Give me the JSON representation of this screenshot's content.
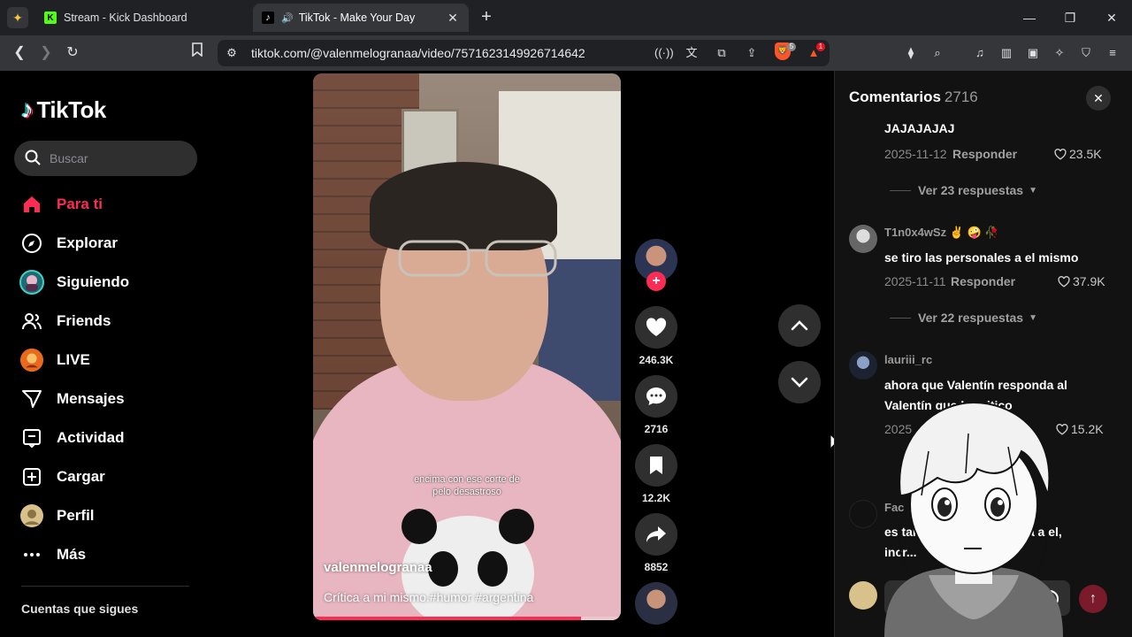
{
  "browser": {
    "tabs": [
      {
        "title": "Stream - Kick Dashboard",
        "active": false
      },
      {
        "title": "TikTok - Make Your Day",
        "active": true
      }
    ],
    "url": "tiktok.com/@valenmelogranaa/video/7571623149926714642",
    "brave_shields_count": "5",
    "rewards_count": "1"
  },
  "sidebar": {
    "logo": "TikTok",
    "search_placeholder": "Buscar",
    "items": [
      {
        "label": "Para ti",
        "icon": "home-icon",
        "active": true
      },
      {
        "label": "Explorar",
        "icon": "compass-icon"
      },
      {
        "label": "Siguiendo",
        "icon": "following-avatar-icon"
      },
      {
        "label": "Friends",
        "icon": "friends-icon"
      },
      {
        "label": "LIVE",
        "icon": "live-avatar-icon"
      },
      {
        "label": "Mensajes",
        "icon": "send-icon"
      },
      {
        "label": "Actividad",
        "icon": "inbox-icon"
      },
      {
        "label": "Cargar",
        "icon": "upload-icon"
      },
      {
        "label": "Perfil",
        "icon": "profile-avatar-icon"
      },
      {
        "label": "Más",
        "icon": "more-icon"
      }
    ],
    "following_title": "Cuentas que sigues"
  },
  "video": {
    "overlay_caption_line1": "encima con ese corte de",
    "overlay_caption_line2": "pelo desastroso",
    "username": "valenmelogranaa",
    "description": "Crítica a mi mismo.#humor #argentina",
    "progress": 0.87,
    "likes": "246.3K",
    "comments": "2716",
    "saves": "12.2K",
    "shares": "8852"
  },
  "comments": {
    "title": "Comentarios",
    "count": "2716",
    "input_placeholder": "A",
    "reply_label": "Responder",
    "items": [
      {
        "text": "JAJAJAJAJ",
        "date": "2025-11-12",
        "likes": "23.5K",
        "replies": "Ver 23 respuestas"
      },
      {
        "user": "T1n0x4wSz ✌ 🤪 🥀",
        "text": "se tiro las personales a el mismo",
        "date": "2025-11-11",
        "likes": "37.9K",
        "replies": "Ver 22 respuestas"
      },
      {
        "user": "lauriii_rc",
        "text": "ahora que Valentín responda al Valentín que lo critico",
        "date": "2025",
        "likes": "15.2K"
      },
      {
        "user": "Fac",
        "text": "es tan i... hace una crítica a el, incr..."
      }
    ]
  },
  "colors": {
    "accent": "#fe2c55",
    "background": "#000000",
    "panel": "#121212"
  }
}
